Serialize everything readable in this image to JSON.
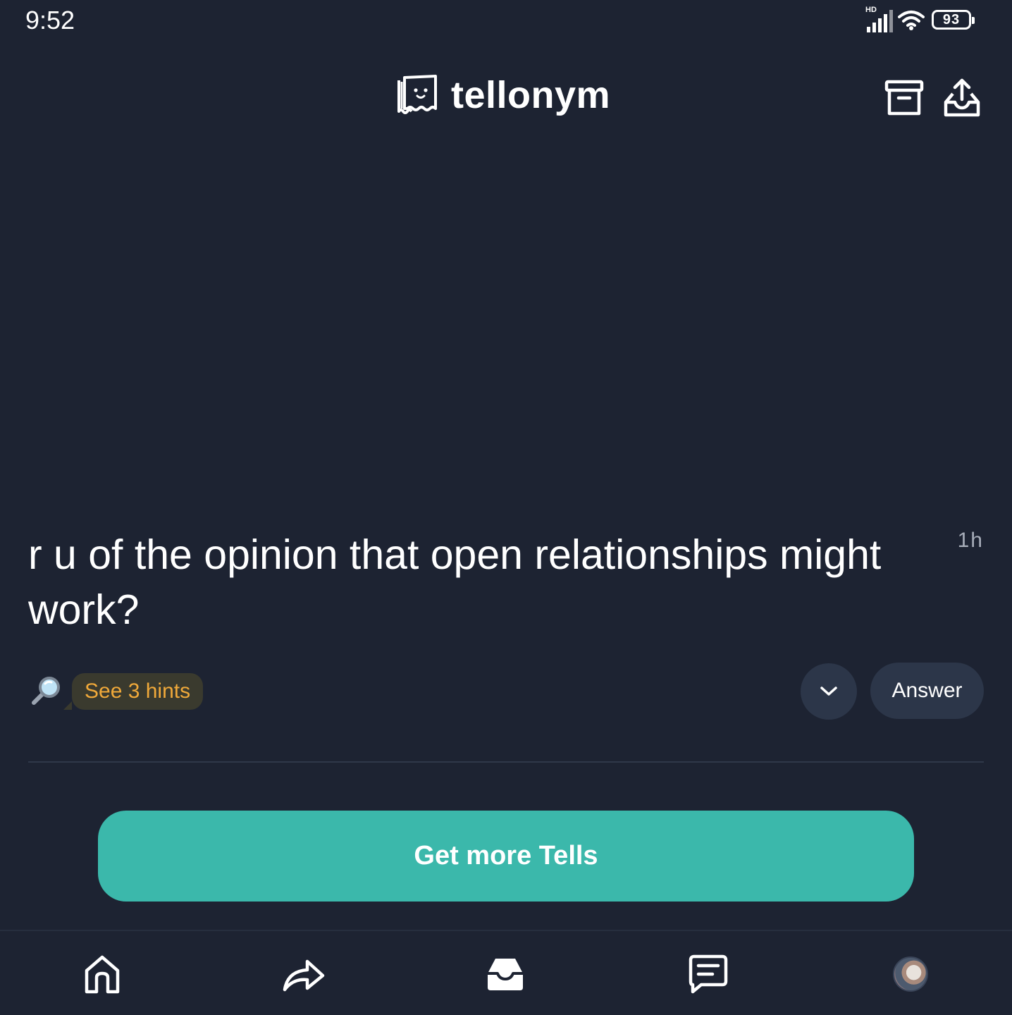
{
  "status_bar": {
    "time": "9:52",
    "network_label": "HD",
    "battery": "93",
    "icons": [
      "signal-icon",
      "wifi-icon",
      "battery-icon"
    ]
  },
  "header": {
    "logo_text": "tellonym",
    "actions": [
      "archive-icon",
      "share-out-icon"
    ]
  },
  "tell": {
    "text": "r u of the opinion that open relationships might work?",
    "time_ago": "1h",
    "hints_label": "See 3 hints",
    "answer_label": "Answer"
  },
  "cta": {
    "label": "Get more Tells"
  },
  "bottom_nav": {
    "items": [
      "home-icon",
      "share-icon",
      "inbox-icon",
      "chat-icon",
      "profile-avatar"
    ],
    "active": "inbox-icon"
  },
  "colors": {
    "background": "#1d2332",
    "accent": "#3bb8ab",
    "hint_text": "#f0a93a",
    "button_bg": "#2c3649",
    "muted_text": "#a7adb9"
  }
}
